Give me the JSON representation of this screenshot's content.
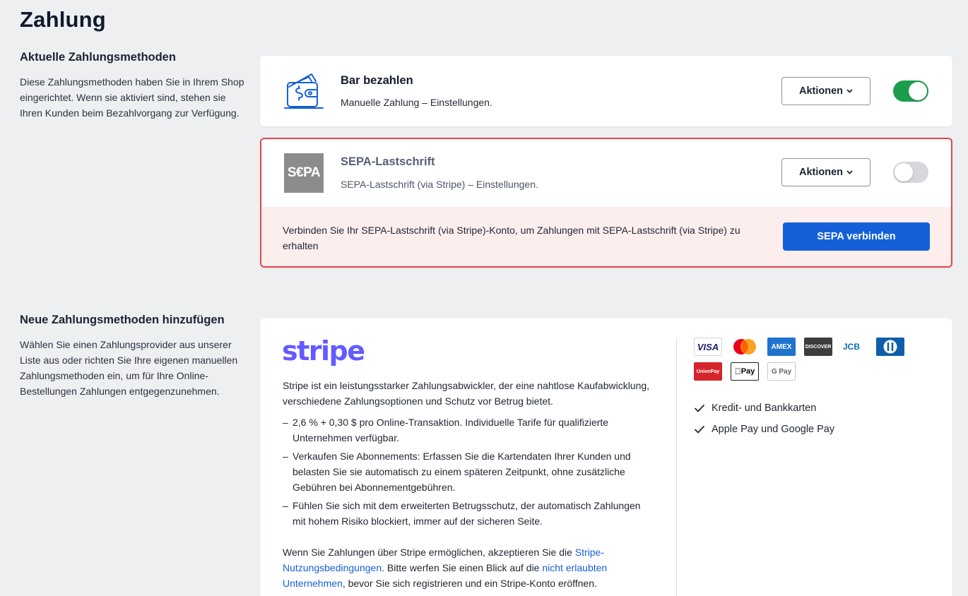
{
  "page": {
    "title": "Zahlung"
  },
  "current_section": {
    "heading": "Aktuelle Zahlungsmethoden",
    "description": "Diese Zahlungsmethoden haben Sie in Ihrem Shop eingerichtet. Wenn sie aktiviert sind, stehen sie Ihren Kunden beim Bezahlvorgang zur Verfügung."
  },
  "methods": [
    {
      "name": "Bar bezahlen",
      "description": "Manuelle Zahlung – Einstellungen.",
      "actions_label": "Aktionen",
      "enabled": true,
      "icon": "cash-wallet-icon"
    },
    {
      "name": "SEPA-Lastschrift",
      "description": "SEPA-Lastschrift (via Stripe) – Einstellungen.",
      "actions_label": "Aktionen",
      "enabled": false,
      "logo_text": "S€PA",
      "warning": "Verbinden Sie Ihr SEPA-Lastschrift (via Stripe)-Konto, um Zahlungen mit SEPA-Lastschrift (via Stripe) zu erhalten",
      "connect_label": "SEPA verbinden"
    }
  ],
  "new_section": {
    "heading": "Neue Zahlungsmethoden hinzufügen",
    "description": "Wählen Sie einen Zahlungsprovider aus unserer Liste aus oder richten Sie Ihre eigenen manuellen Zahlungsmethoden ein, um für Ihre Online-Bestellungen Zahlungen entgegenzunehmen."
  },
  "stripe": {
    "logo": "stripe",
    "intro": "Stripe ist ein leistungsstarker Zahlungsabwickler, der eine nahtlose Kaufabwicklung, verschiedene Zahlungsoptionen und Schutz vor Betrug bietet.",
    "bullets": [
      "2,6 % + 0,30 $ pro Online-Transaktion. Individuelle Tarife für qualifizierte Unternehmen verfügbar.",
      "Verkaufen Sie Abonnements: Erfassen Sie die Kartendaten Ihrer Kunden und belasten Sie sie automatisch zu einem späteren Zeitpunkt, ohne zusätzliche Gebühren bei Abonnementgebühren.",
      "Fühlen Sie sich mit dem erweiterten Betrugsschutz, der automatisch Zahlungen mit hohem Risiko blockiert, immer auf der sicheren Seite."
    ],
    "legal_prefix": "Wenn Sie Zahlungen über Stripe ermöglichen, akzeptieren Sie die ",
    "legal_link1": "Stripe-Nutzungsbedingungen",
    "legal_middle": ". Bitte werfen Sie einen Blick auf die ",
    "legal_link2": "nicht erlaubten Unternehmen",
    "legal_suffix": ", bevor Sie sich registrieren und ein Stripe-Konto eröffnen.",
    "brands": {
      "visa": "VISA",
      "amex": "AMEX",
      "discover": "DISCOVER",
      "jcb": "JCB",
      "unionpay": "UnionPay",
      "applepay": "Pay",
      "gpay": "G Pay"
    },
    "features": [
      "Kredit- und Bankkarten",
      "Apple Pay und Google Pay"
    ]
  },
  "colors": {
    "accent": "#1560d8",
    "toggle_on": "#1a9e4b",
    "error_border": "#e8434d",
    "error_bg": "#fdeeee",
    "stripe": "#635bff"
  }
}
